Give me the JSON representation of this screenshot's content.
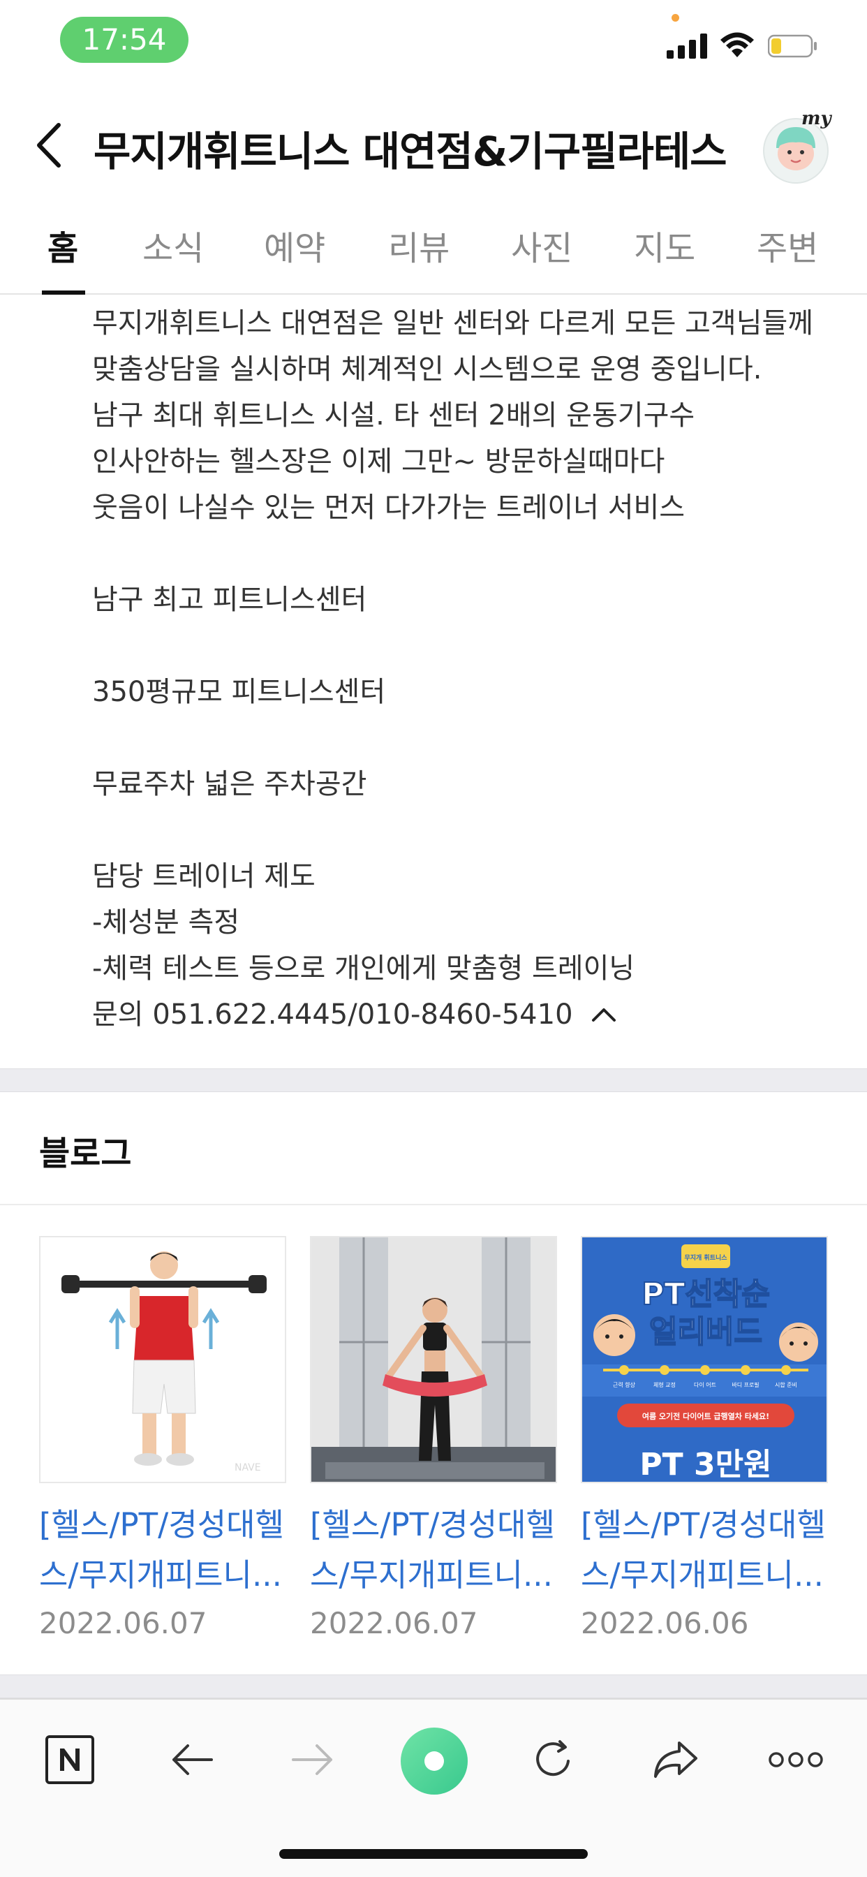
{
  "status_bar": {
    "time": "17:54"
  },
  "header": {
    "title": "무지개휘트니스 대연점&기구필라테스",
    "my_badge": "my"
  },
  "tabs": [
    {
      "label": "홈",
      "active": true
    },
    {
      "label": "소식",
      "active": false
    },
    {
      "label": "예약",
      "active": false
    },
    {
      "label": "리뷰",
      "active": false
    },
    {
      "label": "사진",
      "active": false
    },
    {
      "label": "지도",
      "active": false
    },
    {
      "label": "주변",
      "active": false
    }
  ],
  "description": {
    "lines": [
      "무지개휘트니스 대연점은 일반 센터와 다르게 모든 고객님들께",
      "맞춤상담을 실시하며 체계적인 시스템으로 운영 중입니다.",
      "남구 최대 휘트니스 시설. 타 센터 2배의 운동기구수",
      "인사안하는 헬스장은 이제 그만~ 방문하실때마다",
      "웃음이 나실수 있는 먼저 다가가는 트레이너 서비스",
      "남구 최고 피트니스센터",
      "350평규모 피트니스센터",
      "무료주차 넓은 주차공간",
      "담당 트레이너 제도",
      "-체성분 측정",
      "-체력 테스트 등으로 개인에게 맞춤형 트레이닝"
    ],
    "contact": "문의 051.622.4445/010-8460-5410"
  },
  "blog": {
    "title": "블로그",
    "posts": [
      {
        "title_line1": "[헬스/PT/경성대헬",
        "title_line2": "스/무지개피트니...",
        "date": "2022.06.07"
      },
      {
        "title_line1": "[헬스/PT/경성대헬",
        "title_line2": "스/무지개피트니...",
        "date": "2022.06.07"
      },
      {
        "title_line1": "[헬스/PT/경성대헬",
        "title_line2": "스/무지개피트니...",
        "date": "2022.06.06"
      }
    ],
    "poster": {
      "badge": "무지개 휘트니스",
      "headline1": "PT선착순",
      "headline2": "얼리버드",
      "chips": [
        "근력 향상",
        "체형 교정",
        "다이 어트",
        "바디 프로필",
        "시합 준비"
      ],
      "banner": "여름 오기전 다이어트 급행열차 타세요!",
      "price": "PT 3만원"
    }
  },
  "bottom_nav": {
    "items": [
      "naver-home",
      "back",
      "forward",
      "green-dot",
      "refresh",
      "share",
      "more"
    ]
  },
  "colors": {
    "accent_green": "#5fcf6f",
    "link_blue": "#2d6fcf",
    "poster_blue": "#2f6ac6",
    "poster_yellow": "#f6d24a"
  }
}
